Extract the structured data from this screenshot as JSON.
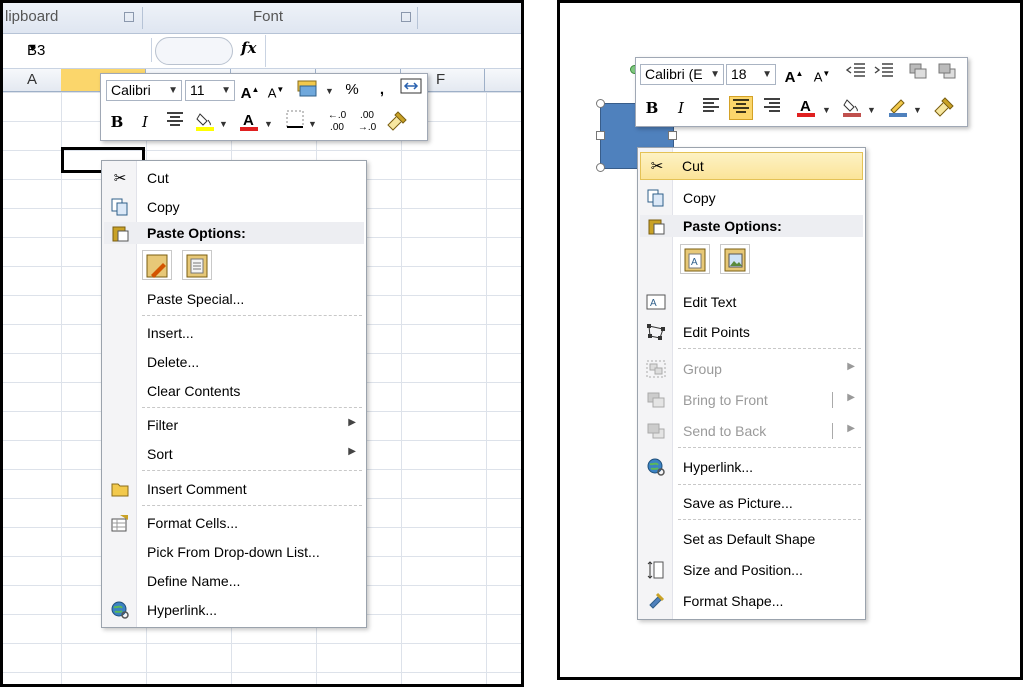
{
  "left": {
    "ribbon": {
      "clipboard": "lipboard",
      "font": "Font"
    },
    "name_box": "B3",
    "fx_label": "fx",
    "columns": [
      "A",
      "F"
    ],
    "toolbar": {
      "font": "Calibri",
      "size": "11",
      "percent": "%",
      "comma": ","
    },
    "menu": {
      "cut": "Cut",
      "copy": "Copy",
      "paste_options": "Paste Options:",
      "paste_special": "Paste Special...",
      "insert": "Insert...",
      "delete": "Delete...",
      "clear_contents": "Clear Contents",
      "filter": "Filter",
      "sort": "Sort",
      "insert_comment": "Insert Comment",
      "format_cells": "Format Cells...",
      "pick_from_list": "Pick From Drop-down List...",
      "define_name": "Define Name...",
      "hyperlink": "Hyperlink..."
    }
  },
  "right": {
    "toolbar": {
      "font": "Calibri (E",
      "size": "18"
    },
    "menu": {
      "cut": "Cut",
      "copy": "Copy",
      "paste_options": "Paste Options:",
      "edit_text": "Edit Text",
      "edit_points": "Edit Points",
      "group": "Group",
      "bring_to_front": "Bring to Front",
      "send_to_back": "Send to Back",
      "hyperlink": "Hyperlink...",
      "save_as_picture": "Save as Picture...",
      "set_default_shape": "Set as Default Shape",
      "size_and_position": "Size and Position...",
      "format_shape": "Format Shape..."
    }
  },
  "colors": {
    "highlight": "#fbe499",
    "shape_fill": "#4f81bd",
    "font_color_bar": "#e02020",
    "highlight_bar": "#ffff00"
  },
  "icons": [
    "scissors-icon",
    "copy-icon",
    "paste-icon",
    "paste-formatting-icon",
    "paste-values-icon",
    "paste-text-icon",
    "paste-picture-icon",
    "folder-comment-icon",
    "format-cells-icon",
    "hyperlink-globe-icon",
    "edit-text-icon",
    "edit-points-icon",
    "group-icon",
    "bring-to-front-icon",
    "send-to-back-icon",
    "size-position-icon",
    "format-shape-icon",
    "bold-icon",
    "italic-icon",
    "align-center-icon",
    "fill-color-icon",
    "font-color-icon",
    "borders-icon",
    "increase-decimal-icon",
    "decrease-decimal-icon",
    "format-painter-icon",
    "grow-font-icon",
    "shrink-font-icon",
    "currency-icon",
    "merge-icon"
  ]
}
